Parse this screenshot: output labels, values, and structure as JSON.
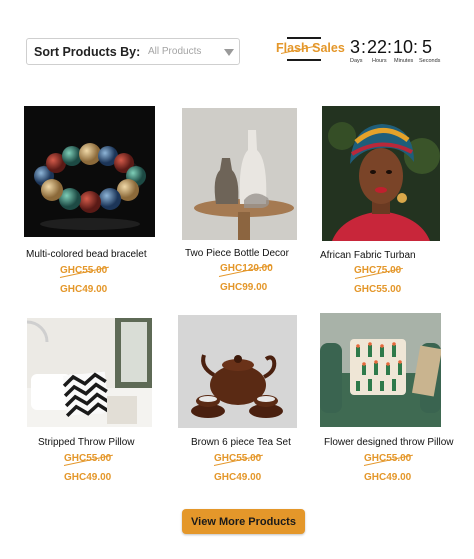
{
  "sort": {
    "label": "Sort Products By:",
    "selected": "All Products"
  },
  "flash_sales": {
    "title": "Flash Sales",
    "countdown": {
      "days": "3",
      "hours": "22",
      "minutes": "10",
      "seconds": "5",
      "days_label": "Days",
      "hours_label": "Hours",
      "minutes_label": "Minutes",
      "seconds_label": "Seconds"
    }
  },
  "products": [
    {
      "name": "Multi-colored bead bracelet",
      "old_price": "GHC55.00",
      "new_price": "GHC49.00"
    },
    {
      "name": "Two Piece Bottle Decor",
      "old_price": "GHC120.00",
      "new_price": "GHC99.00"
    },
    {
      "name": "African Fabric Turban",
      "old_price": "GHC75.00",
      "new_price": "GHC55.00"
    },
    {
      "name": "Stripped Throw Pillow",
      "old_price": "GHC55.00",
      "new_price": "GHC49.00"
    },
    {
      "name": "Brown 6 piece  Tea Set",
      "old_price": "GHC55.00",
      "new_price": "GHC49.00"
    },
    {
      "name": "Flower designed  throw Pillow",
      "old_price": "GHC55.00",
      "new_price": "GHC49.00"
    }
  ],
  "view_more_label": "View More Products",
  "colors": {
    "accent": "#e4972a",
    "text": "#111111"
  }
}
